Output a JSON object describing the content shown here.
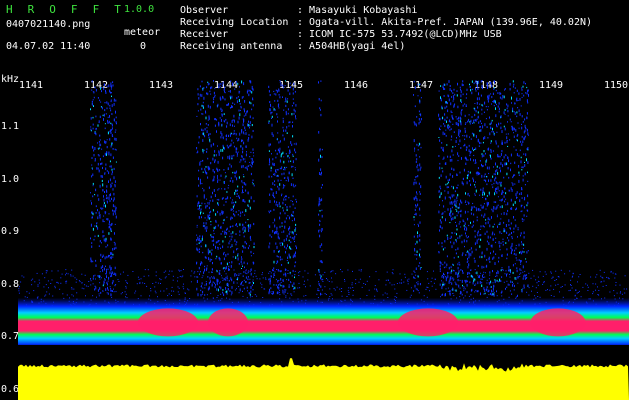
{
  "app": {
    "title": "H R O F F T",
    "version": "1.0.0",
    "filename": "0407021140.png",
    "meteor_label": "meteor",
    "meteor_count": "0",
    "datetime": "04.07.02 11:40"
  },
  "info": {
    "rows": [
      {
        "label": "Observer",
        "value": ": Masayuki Kobayashi"
      },
      {
        "label": "Receiving Location",
        "value": ": Ogata-vill. Akita-Pref. JAPAN (139.96E, 40.02N)"
      },
      {
        "label": "Receiver",
        "value": ": ICOM IC-575 53.7492(@LCD)MHz USB"
      },
      {
        "label": "Receiving antenna",
        "value": ": A504HB(yagi 4el)"
      }
    ]
  },
  "spectrogram": {
    "y_unit": "kHz",
    "x_ticks": [
      "1141",
      "1142",
      "1143",
      "1144",
      "1145",
      "1146",
      "1147",
      "1148",
      "1149",
      "1150"
    ],
    "y_ticks": [
      "1.1",
      "1.0",
      "0.9",
      "0.8",
      "0.7",
      "0.6"
    ],
    "x_range": [
      1140.8,
      1150.2
    ],
    "y_range": [
      0.58,
      1.19
    ],
    "colors": {
      "noise_floor": "#ffff00",
      "carrier": "#ff1f6a",
      "band_edge_green": "#00ff40",
      "band_edge_cyan": "#00e0ff",
      "speckle": "#1030ff",
      "background": "#000000"
    }
  }
}
